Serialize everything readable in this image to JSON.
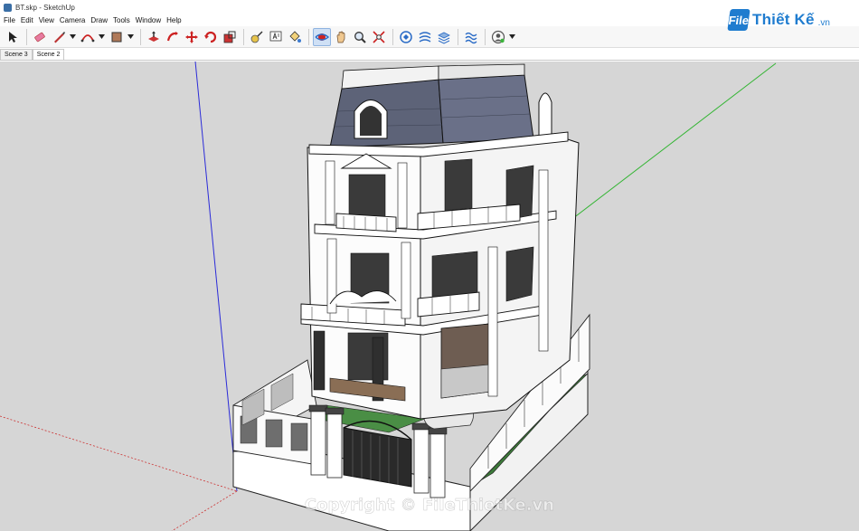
{
  "window": {
    "title": "BT.skp - SketchUp"
  },
  "menu": [
    "File",
    "Edit",
    "View",
    "Camera",
    "Draw",
    "Tools",
    "Window",
    "Help"
  ],
  "toolbar": {
    "tools": [
      {
        "name": "select-tool-icon",
        "active": false,
        "caret": false
      },
      {
        "name": "eraser-tool-icon",
        "active": false,
        "caret": false
      },
      {
        "name": "line-tool-icon",
        "active": false,
        "caret": true
      },
      {
        "name": "arc-tool-icon",
        "active": false,
        "caret": true
      },
      {
        "name": "shape-tool-icon",
        "active": false,
        "caret": true
      },
      {
        "name": "push-pull-tool-icon",
        "active": false,
        "caret": false
      },
      {
        "name": "follow-me-tool-icon",
        "active": false,
        "caret": false
      },
      {
        "name": "move-tool-icon",
        "active": false,
        "caret": false
      },
      {
        "name": "rotate-tool-icon",
        "active": false,
        "caret": false
      },
      {
        "name": "scale-tool-icon",
        "active": false,
        "caret": false
      },
      {
        "name": "tape-measure-tool-icon",
        "active": false,
        "caret": false
      },
      {
        "name": "text-tool-icon",
        "active": false,
        "caret": false
      },
      {
        "name": "paint-bucket-tool-icon",
        "active": false,
        "caret": false
      },
      {
        "name": "orbit-tool-icon",
        "active": true,
        "caret": false
      },
      {
        "name": "pan-tool-icon",
        "active": false,
        "caret": false
      },
      {
        "name": "zoom-tool-icon",
        "active": false,
        "caret": false
      },
      {
        "name": "zoom-extents-tool-icon",
        "active": false,
        "caret": false
      },
      {
        "name": "warehouse-icon",
        "active": false,
        "caret": false
      },
      {
        "name": "extension-warehouse-icon",
        "active": false,
        "caret": false
      },
      {
        "name": "layers-icon",
        "active": false,
        "caret": false
      },
      {
        "name": "sandbox-icon",
        "active": false,
        "caret": false
      },
      {
        "name": "account-icon",
        "active": false,
        "caret": true
      }
    ]
  },
  "logo": {
    "mark": "File",
    "text": "Thiết Kế",
    "suffix": ".vn"
  },
  "scenes": [
    {
      "label": "Scene 3",
      "active": false
    },
    {
      "label": "Scene 2",
      "active": true
    }
  ],
  "watermark": "Copyright © FileThietKe.vn",
  "colors": {
    "viewport_bg": "#d6d6d6",
    "axis_blue": "#2b2bd8",
    "axis_green": "#33b533",
    "axis_red": "#cc3333",
    "accent": "#1f7ccf"
  }
}
